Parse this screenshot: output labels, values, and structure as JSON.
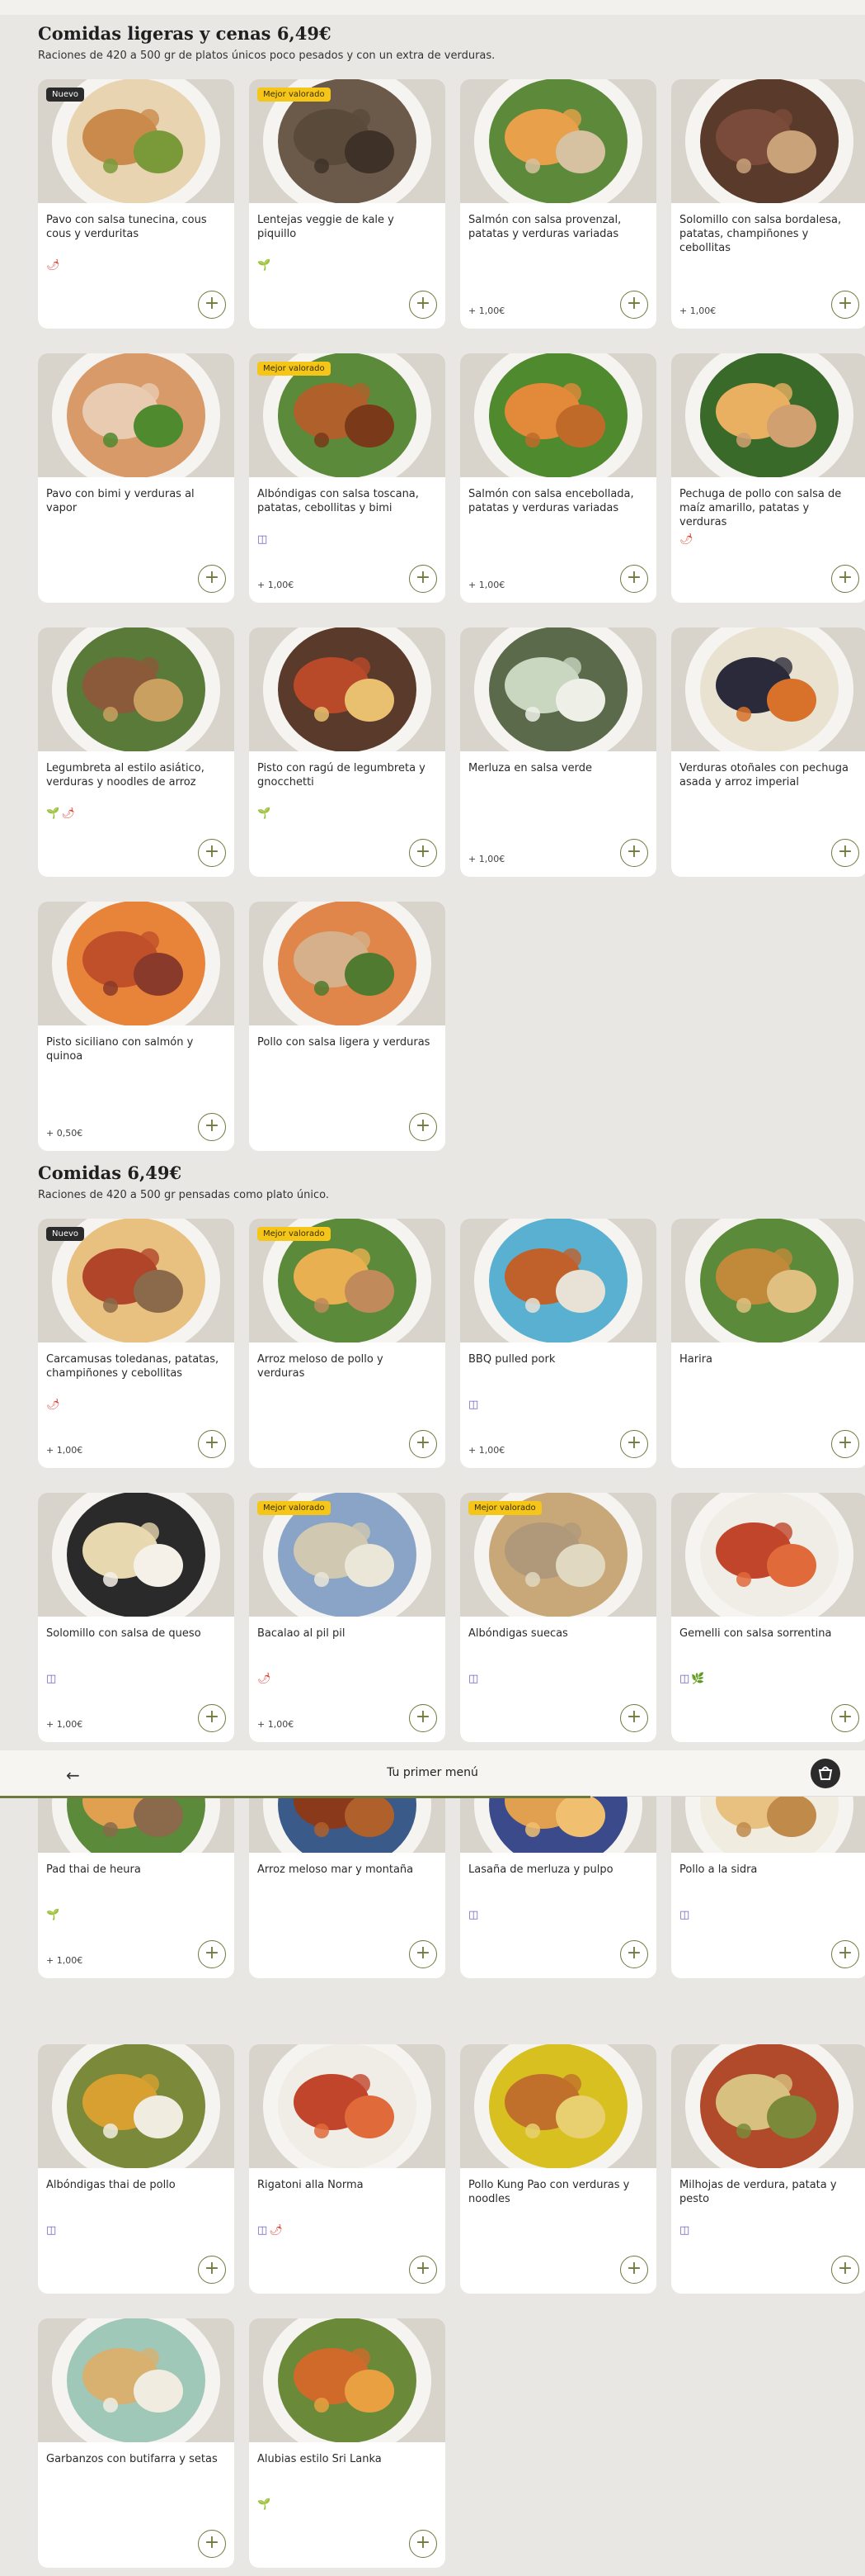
{
  "sections": [
    {
      "title": "Comidas ligeras y cenas 6,49€",
      "subtitle": "Raciones de 420 a 500 gr de platos únicos poco pesados y con un extra de verduras."
    },
    {
      "title": "Comidas 6,49€",
      "subtitle": "Raciones de 420 a 500 gr pensadas como plato único."
    }
  ],
  "nav": {
    "title": "Tu primer menú"
  },
  "icons": {
    "back": "arrow-left-icon",
    "cart": "shopping-bag-icon",
    "add": "plus-icon",
    "spicy": "chili-icon",
    "vegetarian": "sprout-icon",
    "jar": "jar-icon",
    "vegan": "leaf-icon"
  },
  "colors": {
    "accent": "#6d7a3d",
    "badge_new": "#2b2b2b",
    "badge_top": "#f5c518"
  },
  "cards": [
    {
      "name": "Pavo con salsa tunecina, cous cous y verduritas",
      "badge": "Nuevo",
      "tags": [
        "chili"
      ],
      "extra": "",
      "add": "+"
    },
    {
      "name": "Lentejas veggie de kale y piquillo",
      "badge": "Mejor valorado",
      "tags": [
        "veg"
      ],
      "extra": "",
      "add": "+"
    },
    {
      "name": "Salmón con salsa provenzal, patatas y verduras variadas",
      "badge": "",
      "tags": [],
      "extra": "+ 1,00€",
      "add": "+"
    },
    {
      "name": "Solomillo con salsa bordalesa, patatas, champiñones y cebollitas",
      "badge": "",
      "tags": [],
      "extra": "+ 1,00€",
      "add": "+"
    },
    {
      "name": "Pavo con bimi y verduras al vapor",
      "badge": "",
      "tags": [],
      "extra": "",
      "add": "+"
    },
    {
      "name": "Albóndigas con salsa toscana, patatas, cebollitas y bimi",
      "badge": "Mejor valorado",
      "tags": [
        "jar"
      ],
      "extra": "+ 1,00€",
      "add": "+"
    },
    {
      "name": "Salmón con salsa encebollada, patatas y verduras variadas",
      "badge": "",
      "tags": [],
      "extra": "+ 1,00€",
      "add": "+"
    },
    {
      "name": "Pechuga de pollo con salsa de maíz amarillo, patatas y verduras",
      "badge": "",
      "tags": [
        "chili"
      ],
      "extra": "",
      "add": "+"
    },
    {
      "name": "Legumbreta al estilo asiático, verduras y noodles de arroz",
      "badge": "",
      "tags": [
        "veg",
        "chili"
      ],
      "extra": "",
      "add": "+"
    },
    {
      "name": "Pisto con ragú de legumbreta y gnocchetti",
      "badge": "",
      "tags": [
        "veg"
      ],
      "extra": "",
      "add": "+"
    },
    {
      "name": "Merluza en salsa verde",
      "badge": "",
      "tags": [],
      "extra": "+ 1,00€",
      "add": "+"
    },
    {
      "name": "Verduras otoñales con pechuga asada y arroz imperial",
      "badge": "",
      "tags": [],
      "extra": "",
      "add": "+"
    },
    {
      "name": "Pisto siciliano con salmón y quinoa",
      "badge": "",
      "tags": [],
      "extra": "+ 0,50€",
      "add": "+"
    },
    {
      "name": "Pollo con salsa ligera y verduras",
      "badge": "",
      "tags": [],
      "extra": "",
      "add": "+"
    },
    {
      "name": "Carcamusas toledanas, patatas, champiñones y cebollitas",
      "badge": "Nuevo",
      "tags": [
        "chili"
      ],
      "extra": "+ 1,00€",
      "add": "+"
    },
    {
      "name": "Arroz meloso de pollo y verduras",
      "badge": "Mejor valorado",
      "tags": [],
      "extra": "",
      "add": "+"
    },
    {
      "name": "BBQ pulled pork",
      "badge": "",
      "tags": [
        "jar"
      ],
      "extra": "+ 1,00€",
      "add": "+"
    },
    {
      "name": "Harira",
      "badge": "",
      "tags": [],
      "extra": "",
      "add": "+"
    },
    {
      "name": "Solomillo con salsa de queso",
      "badge": "",
      "tags": [
        "jar"
      ],
      "extra": "+ 1,00€",
      "add": "+"
    },
    {
      "name": "Bacalao al pil pil",
      "badge": "Mejor valorado",
      "tags": [
        "chili"
      ],
      "extra": "+ 1,00€",
      "add": "+"
    },
    {
      "name": "Albóndigas suecas",
      "badge": "Mejor valorado",
      "tags": [
        "jar"
      ],
      "extra": "",
      "add": "+"
    },
    {
      "name": "Gemelli con salsa sorrentina",
      "badge": "",
      "tags": [
        "jar",
        "leaf"
      ],
      "extra": "",
      "add": "+"
    },
    {
      "name": "Pad thai de heura",
      "badge": "",
      "tags": [
        "veg"
      ],
      "extra": "+ 1,00€",
      "add": "+"
    },
    {
      "name": "Arroz meloso mar y montaña",
      "badge": "",
      "tags": [],
      "extra": "",
      "add": "+"
    },
    {
      "name": "Lasaña de merluza y pulpo",
      "badge": "",
      "tags": [
        "jar"
      ],
      "extra": "",
      "add": "+"
    },
    {
      "name": "Pollo a la sidra",
      "badge": "",
      "tags": [
        "jar"
      ],
      "extra": "",
      "add": "+"
    },
    {
      "name": "Albóndigas thai de pollo",
      "badge": "",
      "tags": [
        "jar"
      ],
      "extra": "",
      "add": "+"
    },
    {
      "name": "Rigatoni alla Norma",
      "badge": "",
      "tags": [
        "jar",
        "chili"
      ],
      "extra": "",
      "add": "+"
    },
    {
      "name": "Pollo Kung Pao con verduras y noodles",
      "badge": "",
      "tags": [],
      "extra": "",
      "add": "+"
    },
    {
      "name": "Milhojas de verdura, patata y pesto",
      "badge": "",
      "tags": [
        "jar"
      ],
      "extra": "",
      "add": "+"
    },
    {
      "name": "Garbanzos con butifarra y setas",
      "badge": "",
      "tags": [],
      "extra": "",
      "add": "+"
    },
    {
      "name": "Alubias estilo Sri Lanka",
      "badge": "",
      "tags": [
        "veg"
      ],
      "extra": "",
      "add": "+"
    }
  ]
}
